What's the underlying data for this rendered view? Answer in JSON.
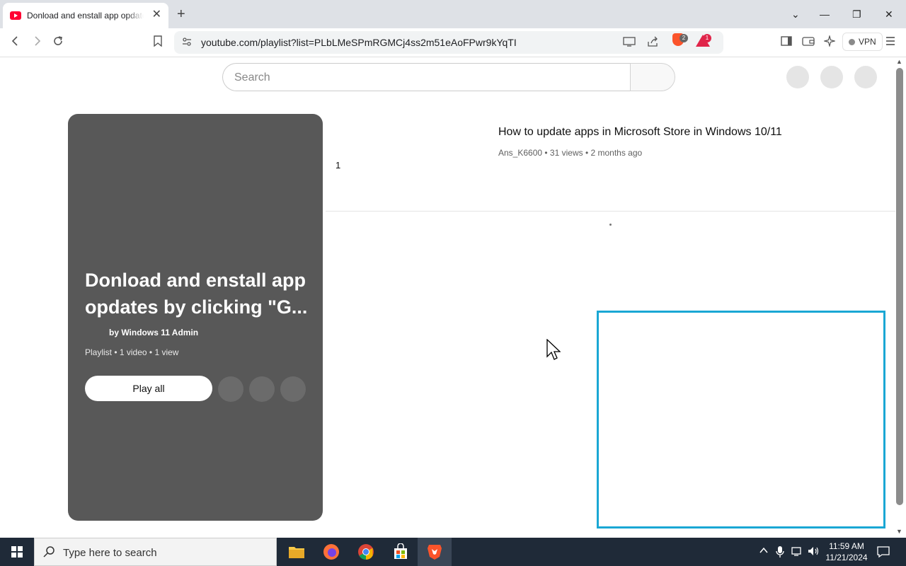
{
  "browser": {
    "tab": {
      "title": "Donload and enstall app opdates by clicking \"Get updates\"",
      "close_glyph": "✕"
    },
    "new_tab_glyph": "+",
    "window_controls": {
      "dropdown": "⌄",
      "minimize": "—",
      "restore": "❐",
      "close": "✕"
    },
    "url": "youtube.com/playlist?list=PLbLMeSPmRGMCj4ss2m51eAoFPwr9kYqTI",
    "brave_shields_count": "2",
    "rewards_count": "1",
    "vpn_label": "VPN"
  },
  "youtube": {
    "search": {
      "placeholder": "Search"
    },
    "playlist": {
      "title": "Donload and enstall app opdates by clicking \"G...",
      "owner": "by Windows 11 Admin",
      "meta": "Playlist • 1 video • 1 view",
      "play_all": "Play all"
    },
    "videos": [
      {
        "index": "1",
        "title": "How to update apps in Microsoft Store in Windows 10/11",
        "meta": "Ans_K6600 • 31 views • 2 months ago"
      }
    ]
  },
  "taskbar": {
    "search_placeholder": "Type here to search",
    "time": "11:59 AM",
    "date": "11/21/2024"
  },
  "colors": {
    "card": "#585858",
    "highlight_box": "#1aa7d4",
    "youtube_red": "#ff0033",
    "taskbar": "#1f2a38"
  }
}
